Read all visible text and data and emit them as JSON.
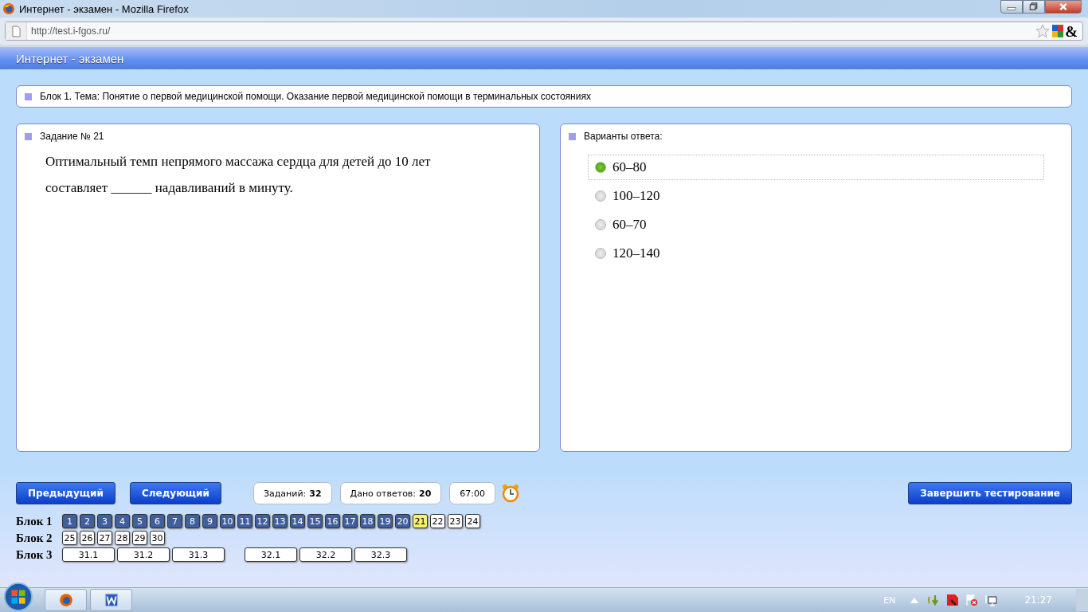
{
  "window": {
    "title": "Интернет - экзамен - Mozilla Firefox"
  },
  "address_bar": {
    "url": "http://test.i-fgos.ru/",
    "addon_text": "&"
  },
  "app": {
    "title": "Интернет - экзамен"
  },
  "block_banner": "Блок 1. Тема: Понятие о первой медицинской помощи. Оказание первой медицинской помощи в терминальных состояниях",
  "task": {
    "heading": "Задание № 21",
    "text": "Оптимальный темп непрямого массажа сердца для детей до 10 лет составляет ______ надавливаний в минуту."
  },
  "answers": {
    "heading": "Варианты ответа:",
    "options": [
      {
        "label": "60–80",
        "selected": true
      },
      {
        "label": "100–120",
        "selected": false
      },
      {
        "label": "60–70",
        "selected": false
      },
      {
        "label": "120–140",
        "selected": false
      }
    ]
  },
  "footer": {
    "prev": "Предыдущий",
    "next": "Следующий",
    "stats": [
      {
        "label": "Заданий:",
        "value": "32"
      },
      {
        "label": "Дано ответов:",
        "value": "20"
      }
    ],
    "timer": "67:00",
    "finish": "Завершить тестирование"
  },
  "blocks": [
    {
      "label": "Блок 1",
      "groups": [
        [
          {
            "n": "1",
            "answered": true,
            "selected": false
          },
          {
            "n": "2",
            "answered": true,
            "selected": false
          },
          {
            "n": "3",
            "answered": true,
            "selected": false
          },
          {
            "n": "4",
            "answered": true,
            "selected": false
          },
          {
            "n": "5",
            "answered": true,
            "selected": false
          },
          {
            "n": "6",
            "answered": true,
            "selected": false
          },
          {
            "n": "7",
            "answered": true,
            "selected": false
          },
          {
            "n": "8",
            "answered": true,
            "selected": false
          },
          {
            "n": "9",
            "answered": true,
            "selected": false
          },
          {
            "n": "10",
            "answered": true,
            "selected": false
          },
          {
            "n": "11",
            "answered": true,
            "selected": false
          },
          {
            "n": "12",
            "answered": true,
            "selected": false
          },
          {
            "n": "13",
            "answered": true,
            "selected": false
          },
          {
            "n": "14",
            "answered": true,
            "selected": false
          },
          {
            "n": "15",
            "answered": true,
            "selected": false
          },
          {
            "n": "16",
            "answered": true,
            "selected": false
          },
          {
            "n": "17",
            "answered": true,
            "selected": false
          },
          {
            "n": "18",
            "answered": true,
            "selected": false
          },
          {
            "n": "19",
            "answered": true,
            "selected": false
          },
          {
            "n": "20",
            "answered": true,
            "selected": false
          },
          {
            "n": "21",
            "answered": false,
            "selected": true
          },
          {
            "n": "22",
            "answered": false,
            "selected": false
          },
          {
            "n": "23",
            "answered": false,
            "selected": false
          },
          {
            "n": "24",
            "answered": false,
            "selected": false
          }
        ]
      ]
    },
    {
      "label": "Блок 2",
      "groups": [
        [
          {
            "n": "25",
            "answered": false,
            "selected": false
          },
          {
            "n": "26",
            "answered": false,
            "selected": false
          },
          {
            "n": "27",
            "answered": false,
            "selected": false
          },
          {
            "n": "28",
            "answered": false,
            "selected": false
          },
          {
            "n": "29",
            "answered": false,
            "selected": false
          },
          {
            "n": "30",
            "answered": false,
            "selected": false
          }
        ]
      ]
    },
    {
      "label": "Блок 3",
      "groups": [
        [
          {
            "n": "31.1",
            "answered": false,
            "selected": false
          },
          {
            "n": "31.2",
            "answered": false,
            "selected": false
          },
          {
            "n": "31.3",
            "answered": false,
            "selected": false
          }
        ],
        [
          {
            "n": "32.1",
            "answered": false,
            "selected": false
          },
          {
            "n": "32.2",
            "answered": false,
            "selected": false
          },
          {
            "n": "32.3",
            "answered": false,
            "selected": false
          }
        ]
      ]
    }
  ],
  "taskbar": {
    "language": "EN",
    "clock": "21:27"
  }
}
